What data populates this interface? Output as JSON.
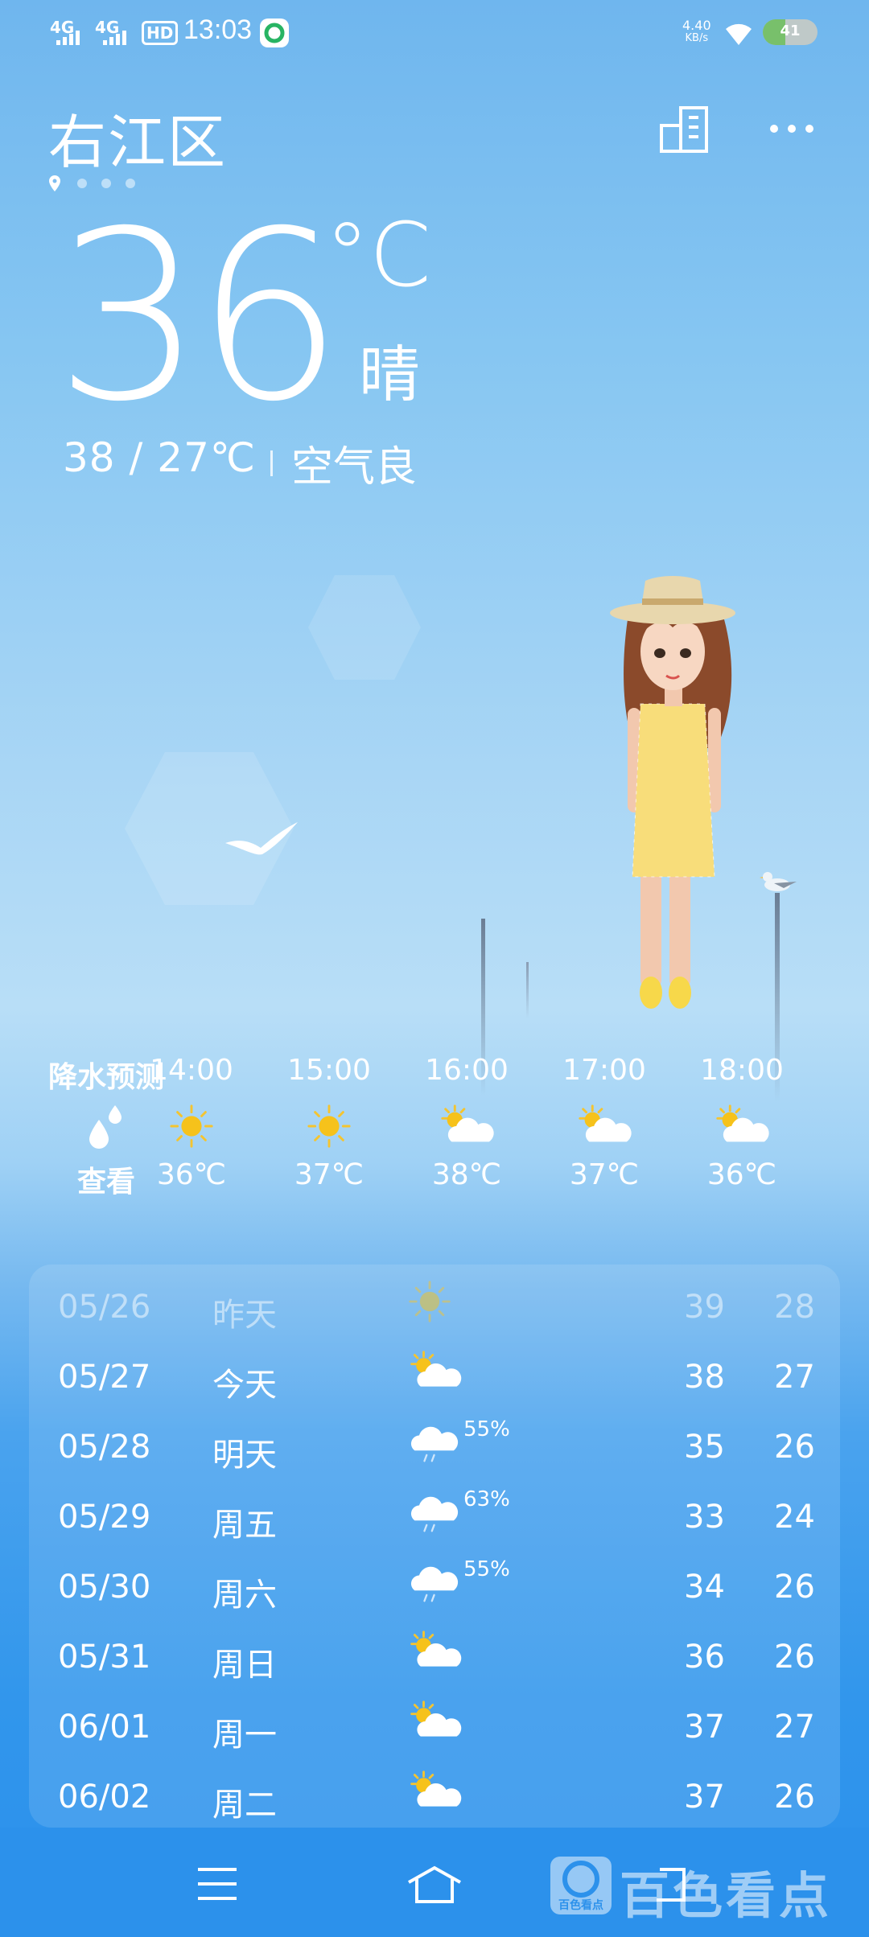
{
  "status_bar": {
    "signal1": "4G",
    "signal2": "4G",
    "hd": "HD",
    "time": "13:03",
    "net_speed": "4.40",
    "net_unit": "KB/s",
    "battery": "41",
    "battery_level": 0.41
  },
  "header": {
    "city": "右江区",
    "page_count": 4
  },
  "current": {
    "temp": "36",
    "unit": "°C",
    "condition": "晴",
    "range": "38 / 27℃",
    "air": "空气良"
  },
  "hourly": {
    "precip": {
      "label": "降水预测",
      "action": "查看"
    },
    "items": [
      {
        "time": "14:00",
        "icon": "sun-icon",
        "temp": "36℃"
      },
      {
        "time": "15:00",
        "icon": "sun-icon",
        "temp": "37℃"
      },
      {
        "time": "16:00",
        "icon": "partly-cloudy-icon",
        "temp": "38℃"
      },
      {
        "time": "17:00",
        "icon": "partly-cloudy-icon",
        "temp": "37℃"
      },
      {
        "time": "18:00",
        "icon": "partly-cloudy-icon",
        "temp": "36℃"
      }
    ]
  },
  "daily": [
    {
      "date": "05/26",
      "day": "昨天",
      "icon": "sun-icon",
      "pct": "",
      "hi": "39",
      "lo": "28"
    },
    {
      "date": "05/27",
      "day": "今天",
      "icon": "partly-cloudy-icon",
      "pct": "",
      "hi": "38",
      "lo": "27"
    },
    {
      "date": "05/28",
      "day": "明天",
      "icon": "rain-cloud-icon",
      "pct": "55%",
      "hi": "35",
      "lo": "26"
    },
    {
      "date": "05/29",
      "day": "周五",
      "icon": "rain-cloud-icon",
      "pct": "63%",
      "hi": "33",
      "lo": "24"
    },
    {
      "date": "05/30",
      "day": "周六",
      "icon": "rain-cloud-icon",
      "pct": "55%",
      "hi": "34",
      "lo": "26"
    },
    {
      "date": "05/31",
      "day": "周日",
      "icon": "partly-cloudy-icon",
      "pct": "",
      "hi": "36",
      "lo": "26"
    },
    {
      "date": "06/01",
      "day": "周一",
      "icon": "partly-cloudy-icon",
      "pct": "",
      "hi": "37",
      "lo": "27"
    },
    {
      "date": "06/02",
      "day": "周二",
      "icon": "partly-cloudy-icon",
      "pct": "",
      "hi": "37",
      "lo": "26"
    }
  ],
  "watermark": "百色看点",
  "watermark_small": "百色看点"
}
